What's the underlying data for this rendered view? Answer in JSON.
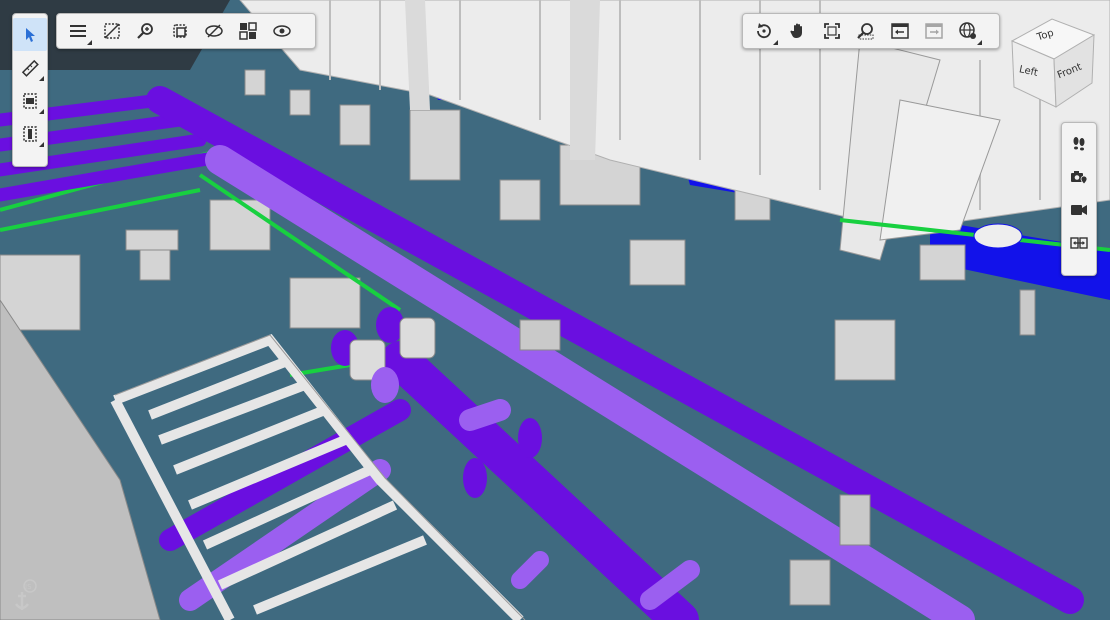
{
  "viewer": {
    "name": "3D model viewer",
    "background_color": "#3f6a80"
  },
  "left_toolbar": {
    "items": [
      {
        "name": "select",
        "icon": "cursor-icon",
        "active": true
      },
      {
        "name": "measure",
        "icon": "ruler-icon",
        "has_submenu": true
      },
      {
        "name": "section",
        "icon": "section-plane-icon",
        "has_submenu": true
      },
      {
        "name": "section-box",
        "icon": "section-box-icon",
        "has_submenu": true
      }
    ]
  },
  "top_toolbar": {
    "items": [
      {
        "name": "model-tree",
        "icon": "menu-icon",
        "has_submenu": true
      },
      {
        "name": "transparency",
        "icon": "transparency-icon"
      },
      {
        "name": "zoom-selection",
        "icon": "zoom-icon"
      },
      {
        "name": "isolate",
        "icon": "isolate-icon"
      },
      {
        "name": "hide",
        "icon": "eye-slash-icon"
      },
      {
        "name": "explode",
        "icon": "grid-icon"
      },
      {
        "name": "show-all",
        "icon": "eye-icon"
      }
    ]
  },
  "nav_toolbar": {
    "items": [
      {
        "name": "orbit",
        "icon": "orbit-icon",
        "has_submenu": true
      },
      {
        "name": "pan",
        "icon": "hand-icon"
      },
      {
        "name": "zoom-extents",
        "icon": "fit-icon"
      },
      {
        "name": "zoom-window",
        "icon": "zoom-window-icon"
      },
      {
        "name": "previous-view",
        "icon": "back-view-icon"
      },
      {
        "name": "next-view",
        "icon": "forward-view-icon",
        "disabled": true
      },
      {
        "name": "projection",
        "icon": "globe-icon",
        "has_submenu": true
      }
    ]
  },
  "right_toolbar": {
    "items": [
      {
        "name": "walk",
        "icon": "footsteps-icon"
      },
      {
        "name": "saved-views",
        "icon": "camera-pin-icon"
      },
      {
        "name": "camera",
        "icon": "video-camera-icon"
      },
      {
        "name": "compare",
        "icon": "compare-icon"
      }
    ]
  },
  "nav_cube": {
    "top": "Top",
    "left": "Left",
    "front": "Front"
  },
  "colors": {
    "pipe_dark": "#6a0fe0",
    "pipe_light": "#9b5ff0",
    "pipe_green": "#18d040",
    "beam_blue": "#1010ee",
    "concrete": "#d6d6d6",
    "steel": "#ececec"
  }
}
